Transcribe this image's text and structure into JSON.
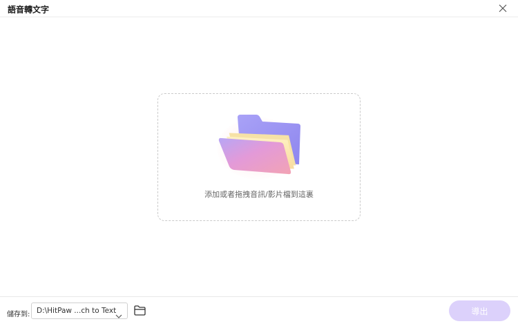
{
  "window": {
    "title": "語音轉文字",
    "close_icon": "close-icon"
  },
  "dropzone": {
    "hint": "添加或者拖拽音訊/影片檔到這裏",
    "icon": "folder-open-illustration"
  },
  "footer": {
    "save_label": "儲存到:",
    "path_value": "D:\\HitPaw ...ch to Text",
    "folder_icon": "folder-icon",
    "export_label": "導出"
  },
  "colors": {
    "export_disabled": "#dcd1fb",
    "dashed_border": "#c9c9c9"
  }
}
